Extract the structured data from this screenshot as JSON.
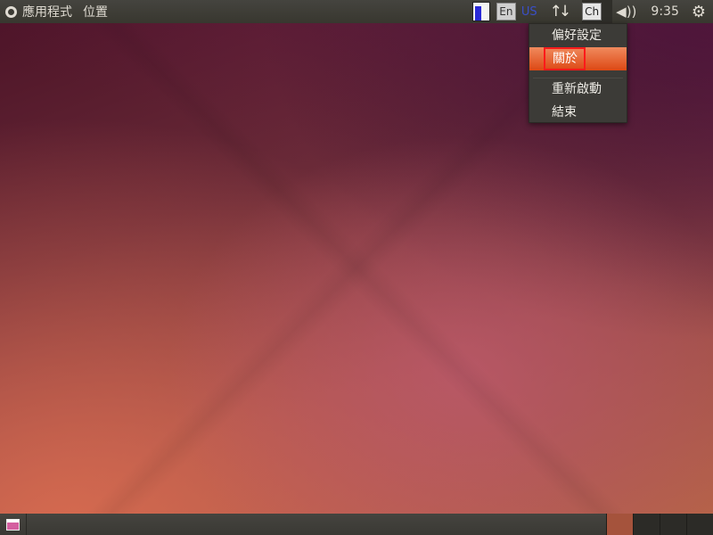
{
  "top_panel": {
    "menus": [
      {
        "label": "應用程式"
      },
      {
        "label": "位置"
      }
    ],
    "tray": {
      "battery_icon": "battery-icon",
      "en_label": "En",
      "keyboard_layout": "US",
      "network_icon": "network-updown-icon",
      "ch_label": "Ch",
      "volume_icon": "volume-icon",
      "clock": "9:35",
      "system_icon": "gear-icon"
    }
  },
  "dropdown": {
    "items": [
      {
        "label": "偏好設定"
      },
      {
        "label": "關於",
        "highlighted": true
      },
      {
        "label": "重新啟動"
      },
      {
        "label": "結束"
      }
    ]
  },
  "bottom_panel": {
    "show_desktop_icon": "show-desktop-icon",
    "workspaces": [
      {
        "active": true
      },
      {
        "active": false
      },
      {
        "active": false
      },
      {
        "active": false
      }
    ]
  },
  "colors": {
    "menu_highlight": "#dd4814",
    "annotation_box": "#ff1a1a",
    "active_workspace": "#a5533c"
  }
}
